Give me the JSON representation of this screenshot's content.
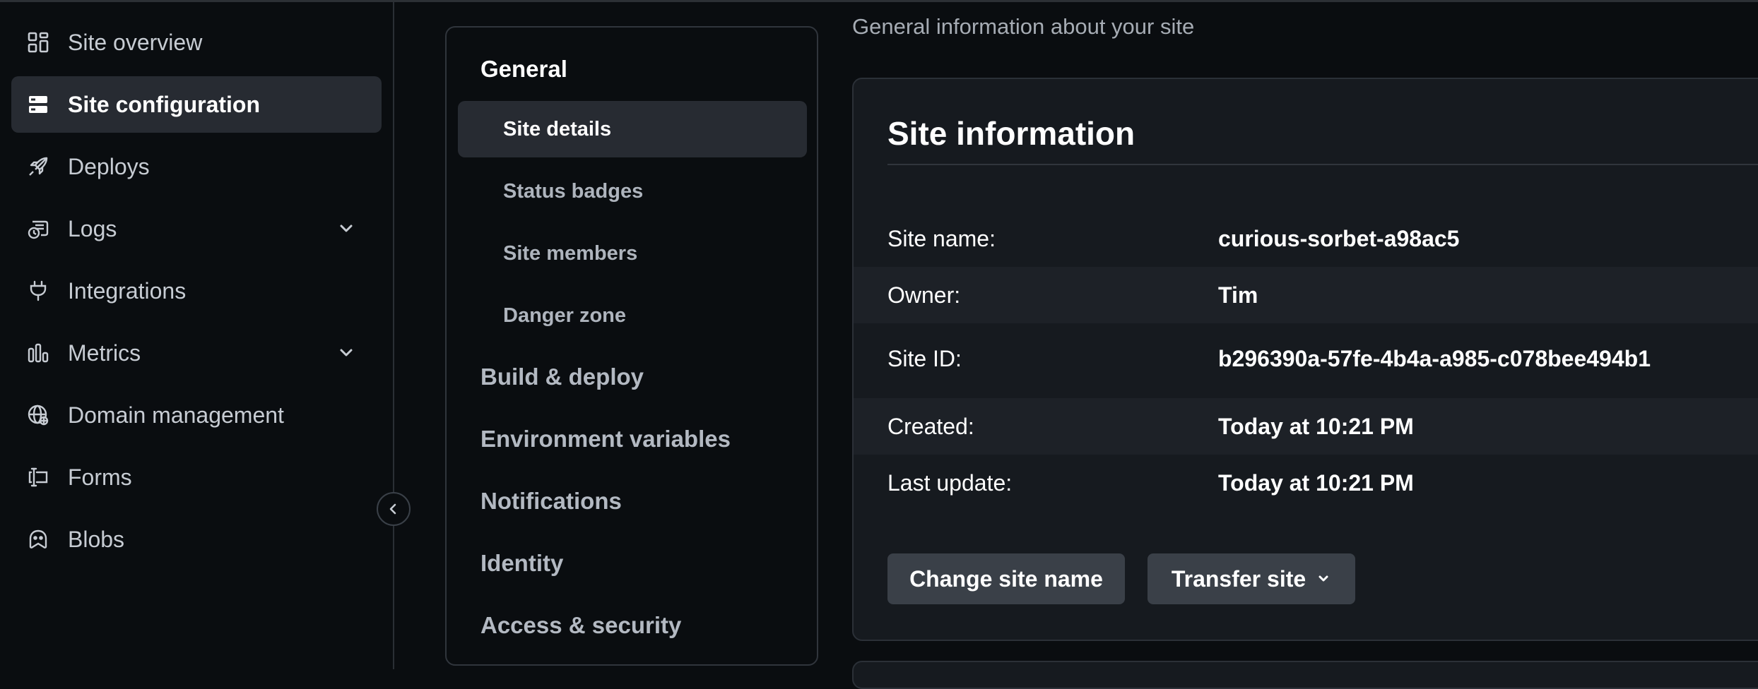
{
  "sidebar": {
    "items": [
      {
        "label": "Site overview",
        "icon": "grid-icon"
      },
      {
        "label": "Site configuration",
        "icon": "server-icon",
        "active": true
      },
      {
        "label": "Deploys",
        "icon": "rocket-icon"
      },
      {
        "label": "Logs",
        "icon": "logs-icon",
        "expandable": true
      },
      {
        "label": "Integrations",
        "icon": "plug-icon"
      },
      {
        "label": "Metrics",
        "icon": "bar-chart-icon",
        "expandable": true
      },
      {
        "label": "Domain management",
        "icon": "globe-icon"
      },
      {
        "label": "Forms",
        "icon": "form-icon"
      },
      {
        "label": "Blobs",
        "icon": "blob-icon"
      }
    ]
  },
  "settings_nav": {
    "sections": [
      {
        "label": "General",
        "items": [
          "Site details",
          "Status badges",
          "Site members",
          "Danger zone"
        ],
        "active_item": "Site details"
      },
      {
        "label": "Build & deploy"
      },
      {
        "label": "Environment variables"
      },
      {
        "label": "Notifications"
      },
      {
        "label": "Identity"
      },
      {
        "label": "Access & security"
      }
    ]
  },
  "main": {
    "description": "General information about your site",
    "card": {
      "title": "Site information",
      "rows": [
        {
          "label": "Site name:",
          "value": "curious-sorbet-a98ac5"
        },
        {
          "label": "Owner:",
          "value": "Tim"
        },
        {
          "label": "Site ID:",
          "value": "b296390a-57fe-4b4a-a985-c078bee494b1"
        },
        {
          "label": "Created:",
          "value": "Today at 10:21 PM"
        },
        {
          "label": "Last update:",
          "value": "Today at 10:21 PM"
        }
      ],
      "buttons": {
        "change_name": "Change site name",
        "transfer": "Transfer site"
      }
    }
  },
  "colors": {
    "background": "#0a0d10",
    "card": "#161a1f",
    "active_item": "#272b32",
    "button": "#3a4048"
  }
}
